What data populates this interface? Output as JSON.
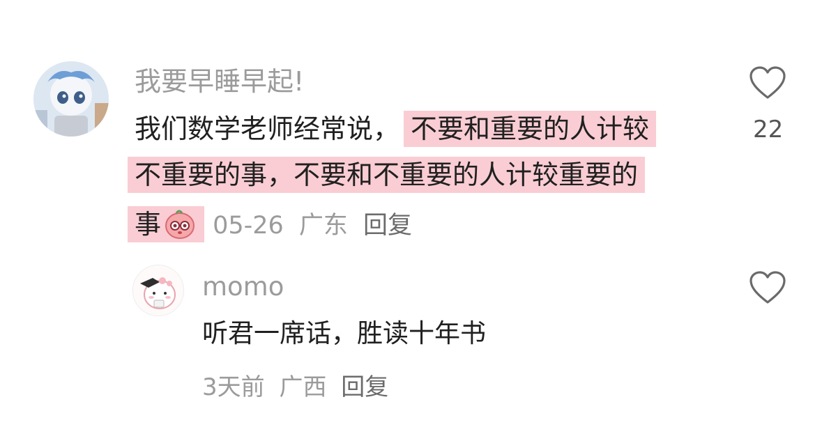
{
  "comment": {
    "username": "我要早睡早起!",
    "text_line1_plain": "我们数学老师经常说，",
    "text_line1_highlight": "不要和重要的人计较",
    "text_line2_highlight": "不重要的事，不要和不重要的人计较重要的",
    "text_line3_highlight": "事",
    "emoji": "pink-blob-emoji",
    "date": "05-26",
    "location": "广东",
    "reply_label": "回复",
    "like_count": "22",
    "highlight_color": "#f9cdd3"
  },
  "reply": {
    "username": "momo",
    "text": "听君一席话，胜读十年书",
    "date": "3天前",
    "location": "广西",
    "reply_label": "回复"
  }
}
